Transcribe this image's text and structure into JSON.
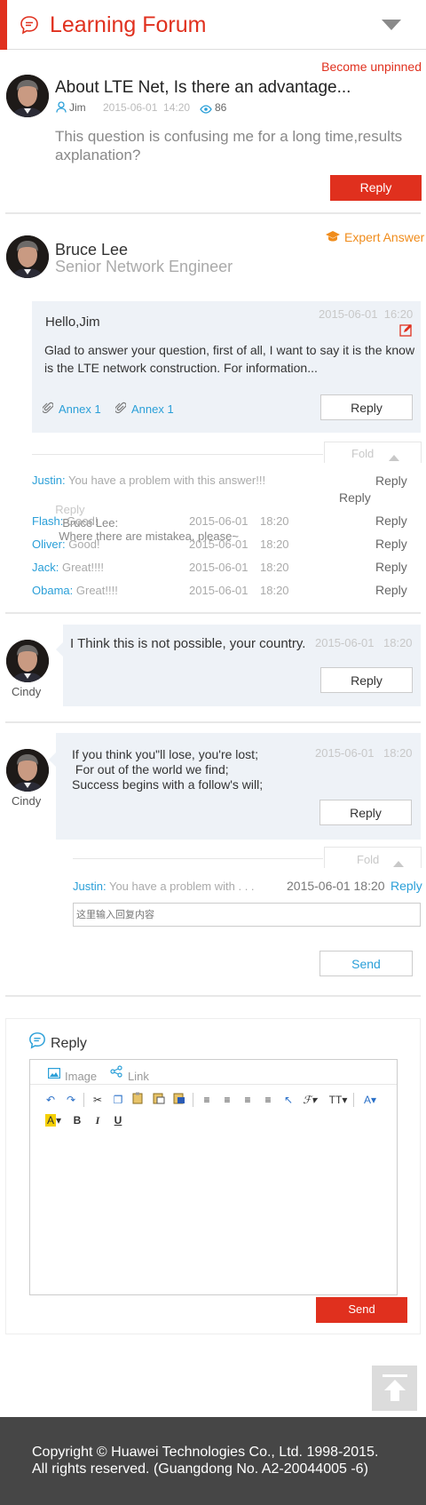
{
  "header": {
    "title": "Learning Forum"
  },
  "post": {
    "unpin_label": "Become unpinned",
    "title": "About LTE Net, Is there an advantage...",
    "author": "Jim",
    "date": "2015-06-01  14:20",
    "views": "86",
    "body": "This question is confusing me for a long time,results axplanation?",
    "reply_label": "Reply"
  },
  "expert": {
    "badge": "Expert Answer",
    "name": "Bruce Lee",
    "role": "Senior Network Engineer",
    "greeting": "Hello,Jim",
    "date": "2015-06-01  16:20",
    "body": "Glad to answer your question, first of all, I want to say it is the know is the LTE network construction. For information...",
    "annex1": "Annex 1",
    "annex2": "Annex 1",
    "reply_label": "Reply",
    "fold_label": "Fold"
  },
  "comments": {
    "justin": {
      "name": "Justin:",
      "text": "You have a problem with this answer!!!",
      "reply": "Reply"
    },
    "nested": {
      "reply_word": "Reply",
      "name": "Bruce Lee:",
      "text": "Where there are mistakea, please~",
      "reply": "Reply"
    },
    "rows": [
      {
        "name": "Flash:",
        "text": "Good!",
        "date": "2015-06-01",
        "time": "18:20",
        "reply": "Reply"
      },
      {
        "name": "Oliver:",
        "text": "Good!",
        "date": "2015-06-01",
        "time": "18:20",
        "reply": "Reply"
      },
      {
        "name": "Jack:",
        "text": "Great!!!!",
        "date": "2015-06-01",
        "time": "18:20",
        "reply": "Reply"
      },
      {
        "name": "Obama:",
        "text": "Great!!!!",
        "date": "2015-06-01",
        "time": "18:20",
        "reply": "Reply"
      }
    ]
  },
  "cindy1": {
    "name": "Cindy",
    "text": "I Think this is not possible, your country.",
    "date": "2015-06-01",
    "time": "18:20",
    "reply_label": "Reply"
  },
  "cindy2": {
    "name": "Cindy",
    "line1": "If you think you\"ll lose, you're lost;",
    "line2": " For out of the world we find;",
    "line3": "Success begins with a follow's will;",
    "date": "2015-06-01",
    "time": "18:20",
    "reply_label": "Reply",
    "fold_label": "Fold",
    "comment_name": "Justin:",
    "comment_text": "You have a problem with . . .",
    "comment_date": "2015-06-01 18:20",
    "comment_reply": "Reply",
    "input_placeholder": "这里输入回复内容",
    "send_label": "Send"
  },
  "reply_box": {
    "title": "Reply",
    "tab_image": "Image",
    "tab_link": "Link",
    "send_label": "Send"
  },
  "footer": {
    "line1": "Copyright © Huawei Technologies Co., Ltd. 1998-2015.",
    "line2": "All rights reserved. (Guangdong No. A2-20044005 -6)"
  },
  "colors": {
    "accent": "#e0301e",
    "link": "#2a9fd8",
    "expert": "#f08c1c",
    "footer": "#464646"
  }
}
